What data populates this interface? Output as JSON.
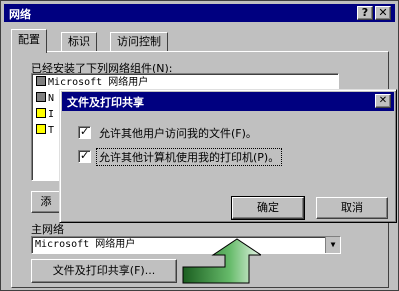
{
  "window": {
    "title": "网络",
    "help_button": "?",
    "close_button": "✕"
  },
  "tabs": [
    {
      "label": "配置",
      "active": true
    },
    {
      "label": "标识",
      "active": false
    },
    {
      "label": "访问控制",
      "active": false
    }
  ],
  "components": {
    "label": "已经安装了下列网络组件(N):",
    "items": [
      {
        "text": "Microsoft 网络用户",
        "icon": "network-client-icon"
      },
      {
        "text": "N",
        "icon": "network-adapter-icon"
      },
      {
        "text": "I",
        "icon": "protocol-icon"
      },
      {
        "text": "T",
        "icon": "protocol-icon"
      }
    ]
  },
  "add_button": "添",
  "primary_logon": {
    "label": "主网络",
    "value": "Microsoft 网络用户"
  },
  "share_button": "文件及打印共享(F)...",
  "dialog": {
    "title": "文件及打印共享",
    "close_button": "✕",
    "options": [
      {
        "label": "允许其他用户访问我的文件(F)。",
        "checked": true
      },
      {
        "label": "允许其他计算机使用我的打印机(P)。",
        "checked": true
      }
    ],
    "ok_label": "确定",
    "cancel_label": "取消"
  },
  "colors": {
    "titlebar": "#000080",
    "face": "#c0c0c0",
    "arrow": "#2e7d32"
  }
}
